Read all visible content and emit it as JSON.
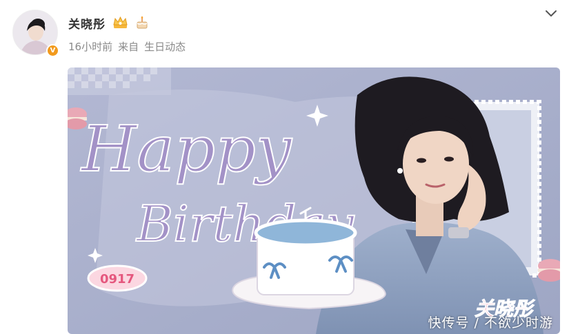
{
  "post": {
    "author_name": "关晓彤",
    "time_ago": "16小时前",
    "source_prefix": "来自",
    "source_name": "生日动态",
    "verified_mark": "V"
  },
  "image": {
    "headline_1": "Happy",
    "headline_2": "Birthday",
    "date_badge": "0917",
    "signature": "关晓彤",
    "watermark": "快传号 / 不欲少时游"
  },
  "icons": [
    "avatar",
    "crown-badge-icon",
    "cake-badge-icon",
    "chevron-down-icon"
  ],
  "colors": {
    "background": "#ffffff",
    "name_text": "#333333",
    "meta_text": "#8a8a8a",
    "verified": "#f29a1c",
    "poster_bg": "#a9b0cc",
    "headline": "#a392c7",
    "signature": "#ee5f87"
  }
}
